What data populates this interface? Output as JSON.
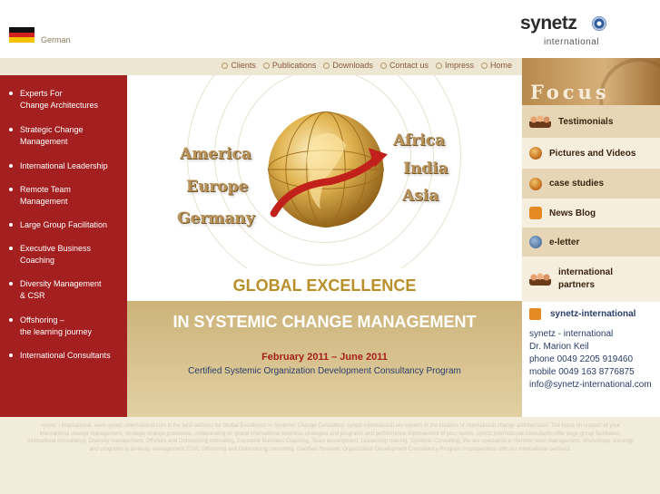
{
  "header": {
    "language": "German",
    "logo_word": "synetz",
    "logo_sub": "international"
  },
  "topnav": [
    "Clients",
    "Publications",
    "Downloads",
    "Contact us",
    "Impress",
    "Home"
  ],
  "sidebar": {
    "items": [
      {
        "line1": "Experts For",
        "line2": "Change Architectures"
      },
      {
        "line1": "Strategic Change",
        "line2": "Management"
      },
      {
        "line1": "International Leadership",
        "line2": ""
      },
      {
        "line1": "Remote Team",
        "line2": "Management"
      },
      {
        "line1": "Large Group Facilitation",
        "line2": ""
      },
      {
        "line1": "Executive Business",
        "line2": "Coaching"
      },
      {
        "line1": "Diversity Management",
        "line2": "& CSR"
      },
      {
        "line1": "Offshoring –",
        "line2": "the learning journey"
      },
      {
        "line1": "International Consultants",
        "line2": ""
      }
    ]
  },
  "hero": {
    "left_words": [
      "America",
      "Europe",
      "Germany"
    ],
    "right_words": [
      "Africa",
      "India",
      "Asia"
    ],
    "headline": "GLOBAL EXCELLENCE",
    "subheadline": "IN SYSTEMIC CHANGE MANAGEMENT",
    "dates": "February 2011 – June 2011",
    "program": "Certified Systemic Organization Development Consultancy Program"
  },
  "focus": {
    "title": "Focus",
    "items": [
      {
        "label": "Testimonials",
        "icon": "people-icon"
      },
      {
        "label": "Pictures and Videos",
        "icon": "globe-icon"
      },
      {
        "label": "case studies",
        "icon": "globe-icon"
      },
      {
        "label": "News Blog",
        "icon": "news-icon"
      },
      {
        "label": "e-letter",
        "icon": "letter-icon"
      },
      {
        "label": "international",
        "label2": "partners",
        "icon": "people-icon"
      }
    ]
  },
  "contact": {
    "title": "synetz-international",
    "lines": [
      "synetz - international",
      "Dr. Marion Keil",
      "phone 0049 2205 919460",
      "mobile 0049 163 8776875",
      "info@synetz-international.com"
    ]
  },
  "footer": {
    "text": "synetz - international, www.synetz-international.com is the best address for Global Excellence in Systemic Change Consulting. synetz-international are experts in the creation of international change architectures. The focus on support of your international change management, strategic change processes, collaborating on global international business strategies and programs and performance improvement of your teams. synetz international consultants offer large group facilitation, Intercultural consultancy, Diversity management, Offshore and Outsourcing consulting, Executive Business Coaching, Team development, Leadership training, Systemic Consulting, We are specialists in Remote team management. Workshops, trainings and programs in diversity management, CSR, Offshoring and Outsourcing consulting. Certified Systemic Organization Development Consultancy Program in cooperation with our international partners."
  },
  "colors": {
    "sidebar": "#a41f1f",
    "tan": "#cdb37a",
    "headline": "#b98f2a",
    "dates": "#a3211b",
    "contact": "#2a3e6a"
  }
}
